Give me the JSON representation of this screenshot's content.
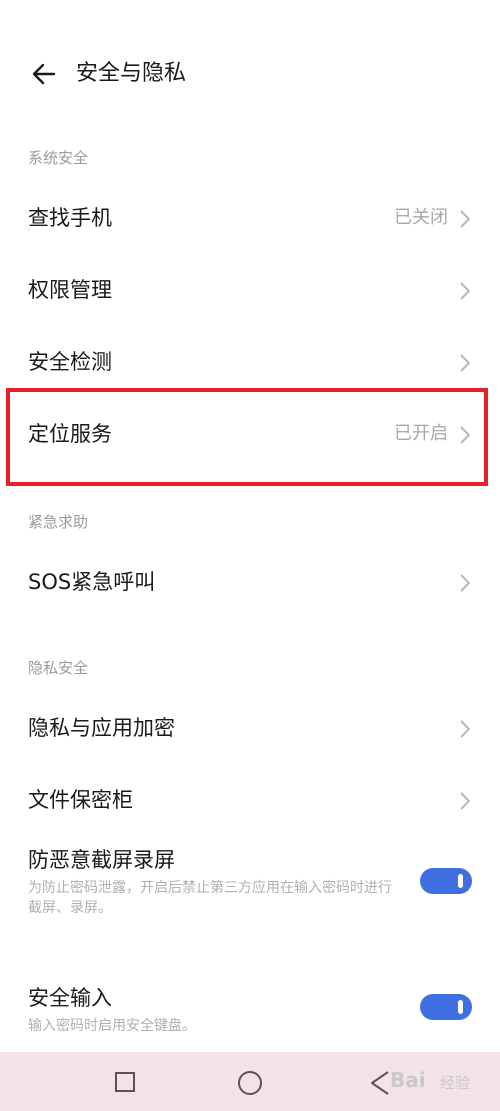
{
  "header": {
    "title": "安全与隐私"
  },
  "sections": {
    "system": "系统安全",
    "emergency": "紧急求助",
    "privacy": "隐私安全"
  },
  "items": {
    "find_phone": {
      "label": "查找手机",
      "status": "已关闭"
    },
    "permissions": {
      "label": "权限管理"
    },
    "security_check": {
      "label": "安全检测"
    },
    "location": {
      "label": "定位服务",
      "status": "已开启"
    },
    "sos": {
      "label": "SOS紧急呼叫"
    },
    "app_encryption": {
      "label": "隐私与应用加密"
    },
    "file_safe": {
      "label": "文件保密柜"
    },
    "anti_screenshot": {
      "label": "防恶意截屏录屏",
      "description": "为防止密码泄露，开启后禁止第三方应用在输入密码时进行截屏、录屏。",
      "enabled": true
    },
    "secure_input": {
      "label": "安全输入",
      "description": "输入密码时启用安全键盘。",
      "enabled": true
    }
  },
  "colors": {
    "accent": "#3f6fe0",
    "highlight": "#e8202a"
  },
  "watermark": {
    "brand": "Bai",
    "text": "经验"
  }
}
